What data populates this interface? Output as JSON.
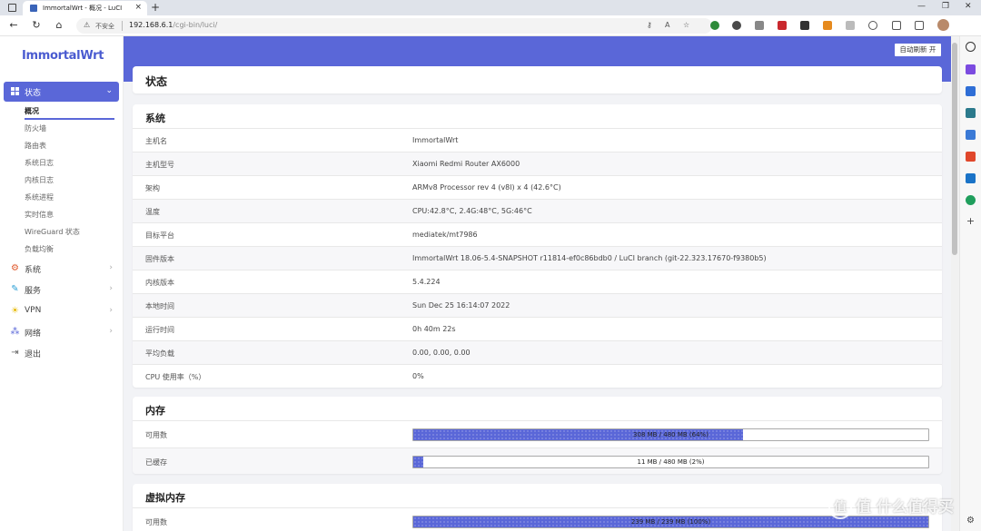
{
  "browser": {
    "tab_title": "ImmortalWrt - 概况 - LuCI",
    "insecure_label": "不安全",
    "url_host": "192.168.6.1",
    "url_path": "/cgi-bin/luci/"
  },
  "sidebar": {
    "logo": "ImmortalWrt",
    "active_menu": "状态",
    "submenu": [
      "概况",
      "防火墙",
      "路由表",
      "系统日志",
      "内核日志",
      "系统进程",
      "实时信息",
      "WireGuard 状态",
      "负载均衡"
    ],
    "menus": [
      "系统",
      "服务",
      "VPN",
      "网络",
      "退出"
    ]
  },
  "header": {
    "auto_refresh": "自动刷新 开"
  },
  "page_title": "状态",
  "system": {
    "title": "系统",
    "rows": [
      {
        "k": "主机名",
        "v": "ImmortalWrt"
      },
      {
        "k": "主机型号",
        "v": "Xiaomi Redmi Router AX6000"
      },
      {
        "k": "架构",
        "v": "ARMv8 Processor rev 4 (v8l) x 4 (42.6°C)"
      },
      {
        "k": "温度",
        "v": "CPU:42.8°C, 2.4G:48°C, 5G:46°C"
      },
      {
        "k": "目标平台",
        "v": "mediatek/mt7986"
      },
      {
        "k": "固件版本",
        "v": "ImmortalWrt 18.06-5.4-SNAPSHOT r11814-ef0c86bdb0 / LuCI branch (git-22.323.17670-f9380b5)"
      },
      {
        "k": "内核版本",
        "v": "5.4.224"
      },
      {
        "k": "本地时间",
        "v": "Sun Dec 25 16:14:07 2022"
      },
      {
        "k": "运行时间",
        "v": "0h 40m 22s"
      },
      {
        "k": "平均负载",
        "v": "0.00, 0.00, 0.00"
      },
      {
        "k": "CPU 使用率（%）",
        "v": "0%"
      }
    ]
  },
  "memory": {
    "title": "内存",
    "rows": [
      {
        "k": "可用数",
        "text": "308 MB / 480 MB (64%)",
        "percent": 64
      },
      {
        "k": "已缓存",
        "text": "11 MB / 480 MB (2%)",
        "percent": 2
      }
    ]
  },
  "swap": {
    "title": "虚拟内存",
    "rows": [
      {
        "k": "可用数",
        "text": "239 MB / 239 MB (100%)",
        "percent": 100
      }
    ]
  },
  "watermark": "值 什么值得买",
  "colors": {
    "accent": "#5a67d8",
    "background": "#f2f3f6"
  }
}
